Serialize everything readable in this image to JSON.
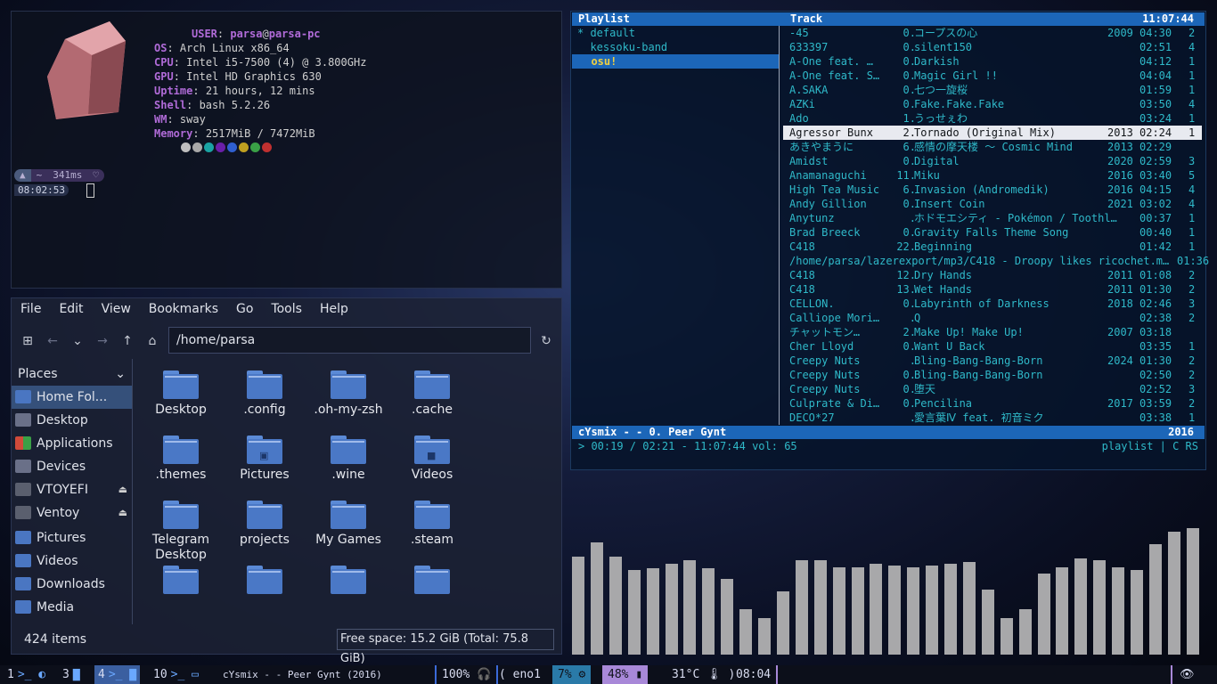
{
  "terminal": {
    "user_key": "USER",
    "user_val": "parsa",
    "host": "parsa-pc",
    "info": [
      {
        "k": "OS",
        "v": "Arch Linux x86_64"
      },
      {
        "k": "CPU",
        "v": "Intel i5-7500 (4) @ 3.800GHz"
      },
      {
        "k": "GPU",
        "v": "Intel HD Graphics 630"
      },
      {
        "k": "Uptime",
        "v": "21 hours, 12 mins"
      },
      {
        "k": "Shell",
        "v": "bash 5.2.26"
      },
      {
        "k": "WM",
        "v": "sway"
      },
      {
        "k": "Memory",
        "v": "2517MiB / 7472MiB"
      }
    ],
    "swatch_colors": [
      "#bfbfbf",
      "#a8a8a8",
      "#1aa3a3",
      "#6a1fa8",
      "#2f5fd0",
      "#c0a020",
      "#3aa046",
      "#c03030"
    ],
    "prompt": {
      "home": "~",
      "time": "341ms",
      "clock": "08:02:53"
    }
  },
  "file_manager": {
    "menu": [
      "File",
      "Edit",
      "View",
      "Bookmarks",
      "Go",
      "Tools",
      "Help"
    ],
    "path": "/home/parsa",
    "places_label": "Places",
    "places": [
      {
        "label": "Home Fol...",
        "selected": true,
        "icon": "home-folder-icon"
      },
      {
        "label": "Desktop",
        "icon": "desktop-icon"
      },
      {
        "label": "Applications",
        "icon": "applications-icon"
      },
      {
        "label": "Devices",
        "icon": "devices-icon"
      },
      {
        "label": "VTOYEFI",
        "icon": "drive-icon",
        "eject": true
      },
      {
        "label": "Ventoy",
        "icon": "drive-icon",
        "eject": true
      },
      {
        "label": "Pictures",
        "icon": "pictures-folder-icon"
      },
      {
        "label": "Videos",
        "icon": "videos-folder-icon"
      },
      {
        "label": "Downloads",
        "icon": "downloads-folder-icon"
      },
      {
        "label": "Media",
        "icon": "media-folder-icon"
      }
    ],
    "files": [
      "Desktop",
      ".config",
      ".oh-my-zsh",
      ".cache",
      ".themes",
      "Pictures",
      ".wine",
      "Videos",
      "Telegram Desktop",
      "projects",
      "My Games",
      ".steam",
      "",
      "",
      "",
      ""
    ],
    "item_count": "424 items",
    "free_space": "Free space: 15.2 GiB (Total: 75.8 GiB)"
  },
  "player": {
    "playlist_header": "Playlist",
    "track_header": "Track",
    "clock": "11:07:44",
    "playlists": [
      "* default",
      "  kessoku-band",
      "  osu!"
    ],
    "tracks": [
      {
        "a": "-45",
        "n": "0.",
        "t": "コープスの心",
        "y": "2009",
        "d": "04:30",
        "c": "2"
      },
      {
        "a": "633397",
        "n": "0.",
        "t": "silent150",
        "y": "",
        "d": "02:51",
        "c": "4"
      },
      {
        "a": "A-One feat. …",
        "n": "0.",
        "t": "Darkish",
        "y": "",
        "d": "04:12",
        "c": "1"
      },
      {
        "a": "A-One feat. S…",
        "n": "0.",
        "t": "Magic Girl !!",
        "y": "",
        "d": "04:04",
        "c": "1"
      },
      {
        "a": "A.SAKA",
        "n": "0.",
        "t": "七つ一旋桜",
        "y": "",
        "d": "01:59",
        "c": "1"
      },
      {
        "a": "AZKi",
        "n": "0.",
        "t": "Fake.Fake.Fake",
        "y": "",
        "d": "03:50",
        "c": "4"
      },
      {
        "a": "Ado",
        "n": "1.",
        "t": "うっせぇわ",
        "y": "",
        "d": "03:24",
        "c": "1"
      },
      {
        "a": "Agressor Bunx",
        "n": "2.",
        "t": "Tornado (Original Mix)",
        "y": "2013",
        "d": "02:24",
        "c": "1",
        "hi": true
      },
      {
        "a": "あきやまうに",
        "n": "6.",
        "t": "感情の摩天楼 ～ Cosmic Mind",
        "y": "2013",
        "d": "02:29",
        "c": ""
      },
      {
        "a": "Amidst",
        "n": "0.",
        "t": "Digital",
        "y": "2020",
        "d": "02:59",
        "c": "3"
      },
      {
        "a": "Anamanaguchi",
        "n": "11.",
        "t": "Miku",
        "y": "2016",
        "d": "03:40",
        "c": "5"
      },
      {
        "a": "High Tea Music",
        "n": "6.",
        "t": "Invasion (Andromedik)",
        "y": "2016",
        "d": "04:15",
        "c": "4"
      },
      {
        "a": "Andy Gillion",
        "n": "0.",
        "t": "Insert Coin",
        "y": "2021",
        "d": "03:02",
        "c": "4"
      },
      {
        "a": "Anytunz",
        "n": ".",
        "t": "ホドモエシティ - Pokémon / Toothl…",
        "y": "",
        "d": "00:37",
        "c": "1"
      },
      {
        "a": "Brad Breeck",
        "n": "0.",
        "t": "Gravity Falls Theme Song",
        "y": "",
        "d": "00:40",
        "c": "1"
      },
      {
        "a": "C418",
        "n": "22.",
        "t": "Beginning",
        "y": "",
        "d": "01:42",
        "c": "1"
      },
      {
        "a": "/home/parsa/lazerexport/mp3/C418 - Droopy likes ricochet.m…",
        "n": "",
        "t": "",
        "y": "",
        "d": "01:36",
        "c": "",
        "path": true
      },
      {
        "a": "C418",
        "n": "12.",
        "t": "Dry Hands",
        "y": "2011",
        "d": "01:08",
        "c": "2"
      },
      {
        "a": "C418",
        "n": "13.",
        "t": "Wet Hands",
        "y": "2011",
        "d": "01:30",
        "c": "2"
      },
      {
        "a": "CELLON.",
        "n": "0.",
        "t": "Labyrinth of Darkness",
        "y": "2018",
        "d": "02:46",
        "c": "3"
      },
      {
        "a": "Calliope Mori…",
        "n": ".",
        "t": "Q",
        "y": "",
        "d": "02:38",
        "c": "2"
      },
      {
        "a": "チャットモン…",
        "n": "2.",
        "t": "Make Up! Make Up!",
        "y": "2007",
        "d": "03:18",
        "c": ""
      },
      {
        "a": "Cher Lloyd",
        "n": "0.",
        "t": "Want U Back",
        "y": "",
        "d": "03:35",
        "c": "1"
      },
      {
        "a": "Creepy Nuts",
        "n": ".",
        "t": "Bling-Bang-Bang-Born",
        "y": "2024",
        "d": "01:30",
        "c": "2"
      },
      {
        "a": "Creepy Nuts",
        "n": "0.",
        "t": "Bling-Bang-Bang-Born",
        "y": "",
        "d": "02:50",
        "c": "2"
      },
      {
        "a": "Creepy Nuts",
        "n": "0.",
        "t": "堕天",
        "y": "",
        "d": "02:52",
        "c": "3"
      },
      {
        "a": "Culprate & Di…",
        "n": "0.",
        "t": "Pencilina",
        "y": "2017",
        "d": "03:59",
        "c": "2"
      },
      {
        "a": "DECO*27",
        "n": ".",
        "t": "愛言葉Ⅳ feat. 初音ミク",
        "y": "",
        "d": "03:38",
        "c": "1"
      }
    ],
    "now_playing": "cYsmix -  -  0. Peer Gynt",
    "now_year": "2016",
    "progress": "> 00:19 / 02:21 - 11:07:44 vol: 65",
    "mode": "playlist | C RS"
  },
  "visualizer": {
    "levels": [
      0.56,
      0.64,
      0.56,
      0.48,
      0.49,
      0.52,
      0.54,
      0.49,
      0.43,
      0.26,
      0.21,
      0.36,
      0.54,
      0.54,
      0.5,
      0.5,
      0.52,
      0.51,
      0.5,
      0.51,
      0.52,
      0.53,
      0.37,
      0.21,
      0.26,
      0.46,
      0.5,
      0.55,
      0.54,
      0.5,
      0.48,
      0.63,
      0.7,
      0.72
    ],
    "color": "#a8a8aa"
  },
  "statusbar": {
    "workspaces": [
      {
        "n": "1",
        "icon": ">_ ◐"
      },
      {
        "n": "3",
        "icon": "▇"
      },
      {
        "n": "4",
        "icon": ">_ ▇",
        "selected": true
      },
      {
        "n": "10",
        "icon": ">_ ▭"
      }
    ],
    "title": "cYsmix -  - Peer Gynt (2016)",
    "volume": "100%",
    "net": "eno1",
    "cpu": "7%",
    "mem": "48%",
    "temp": "31°C",
    "clock": "08:04"
  }
}
